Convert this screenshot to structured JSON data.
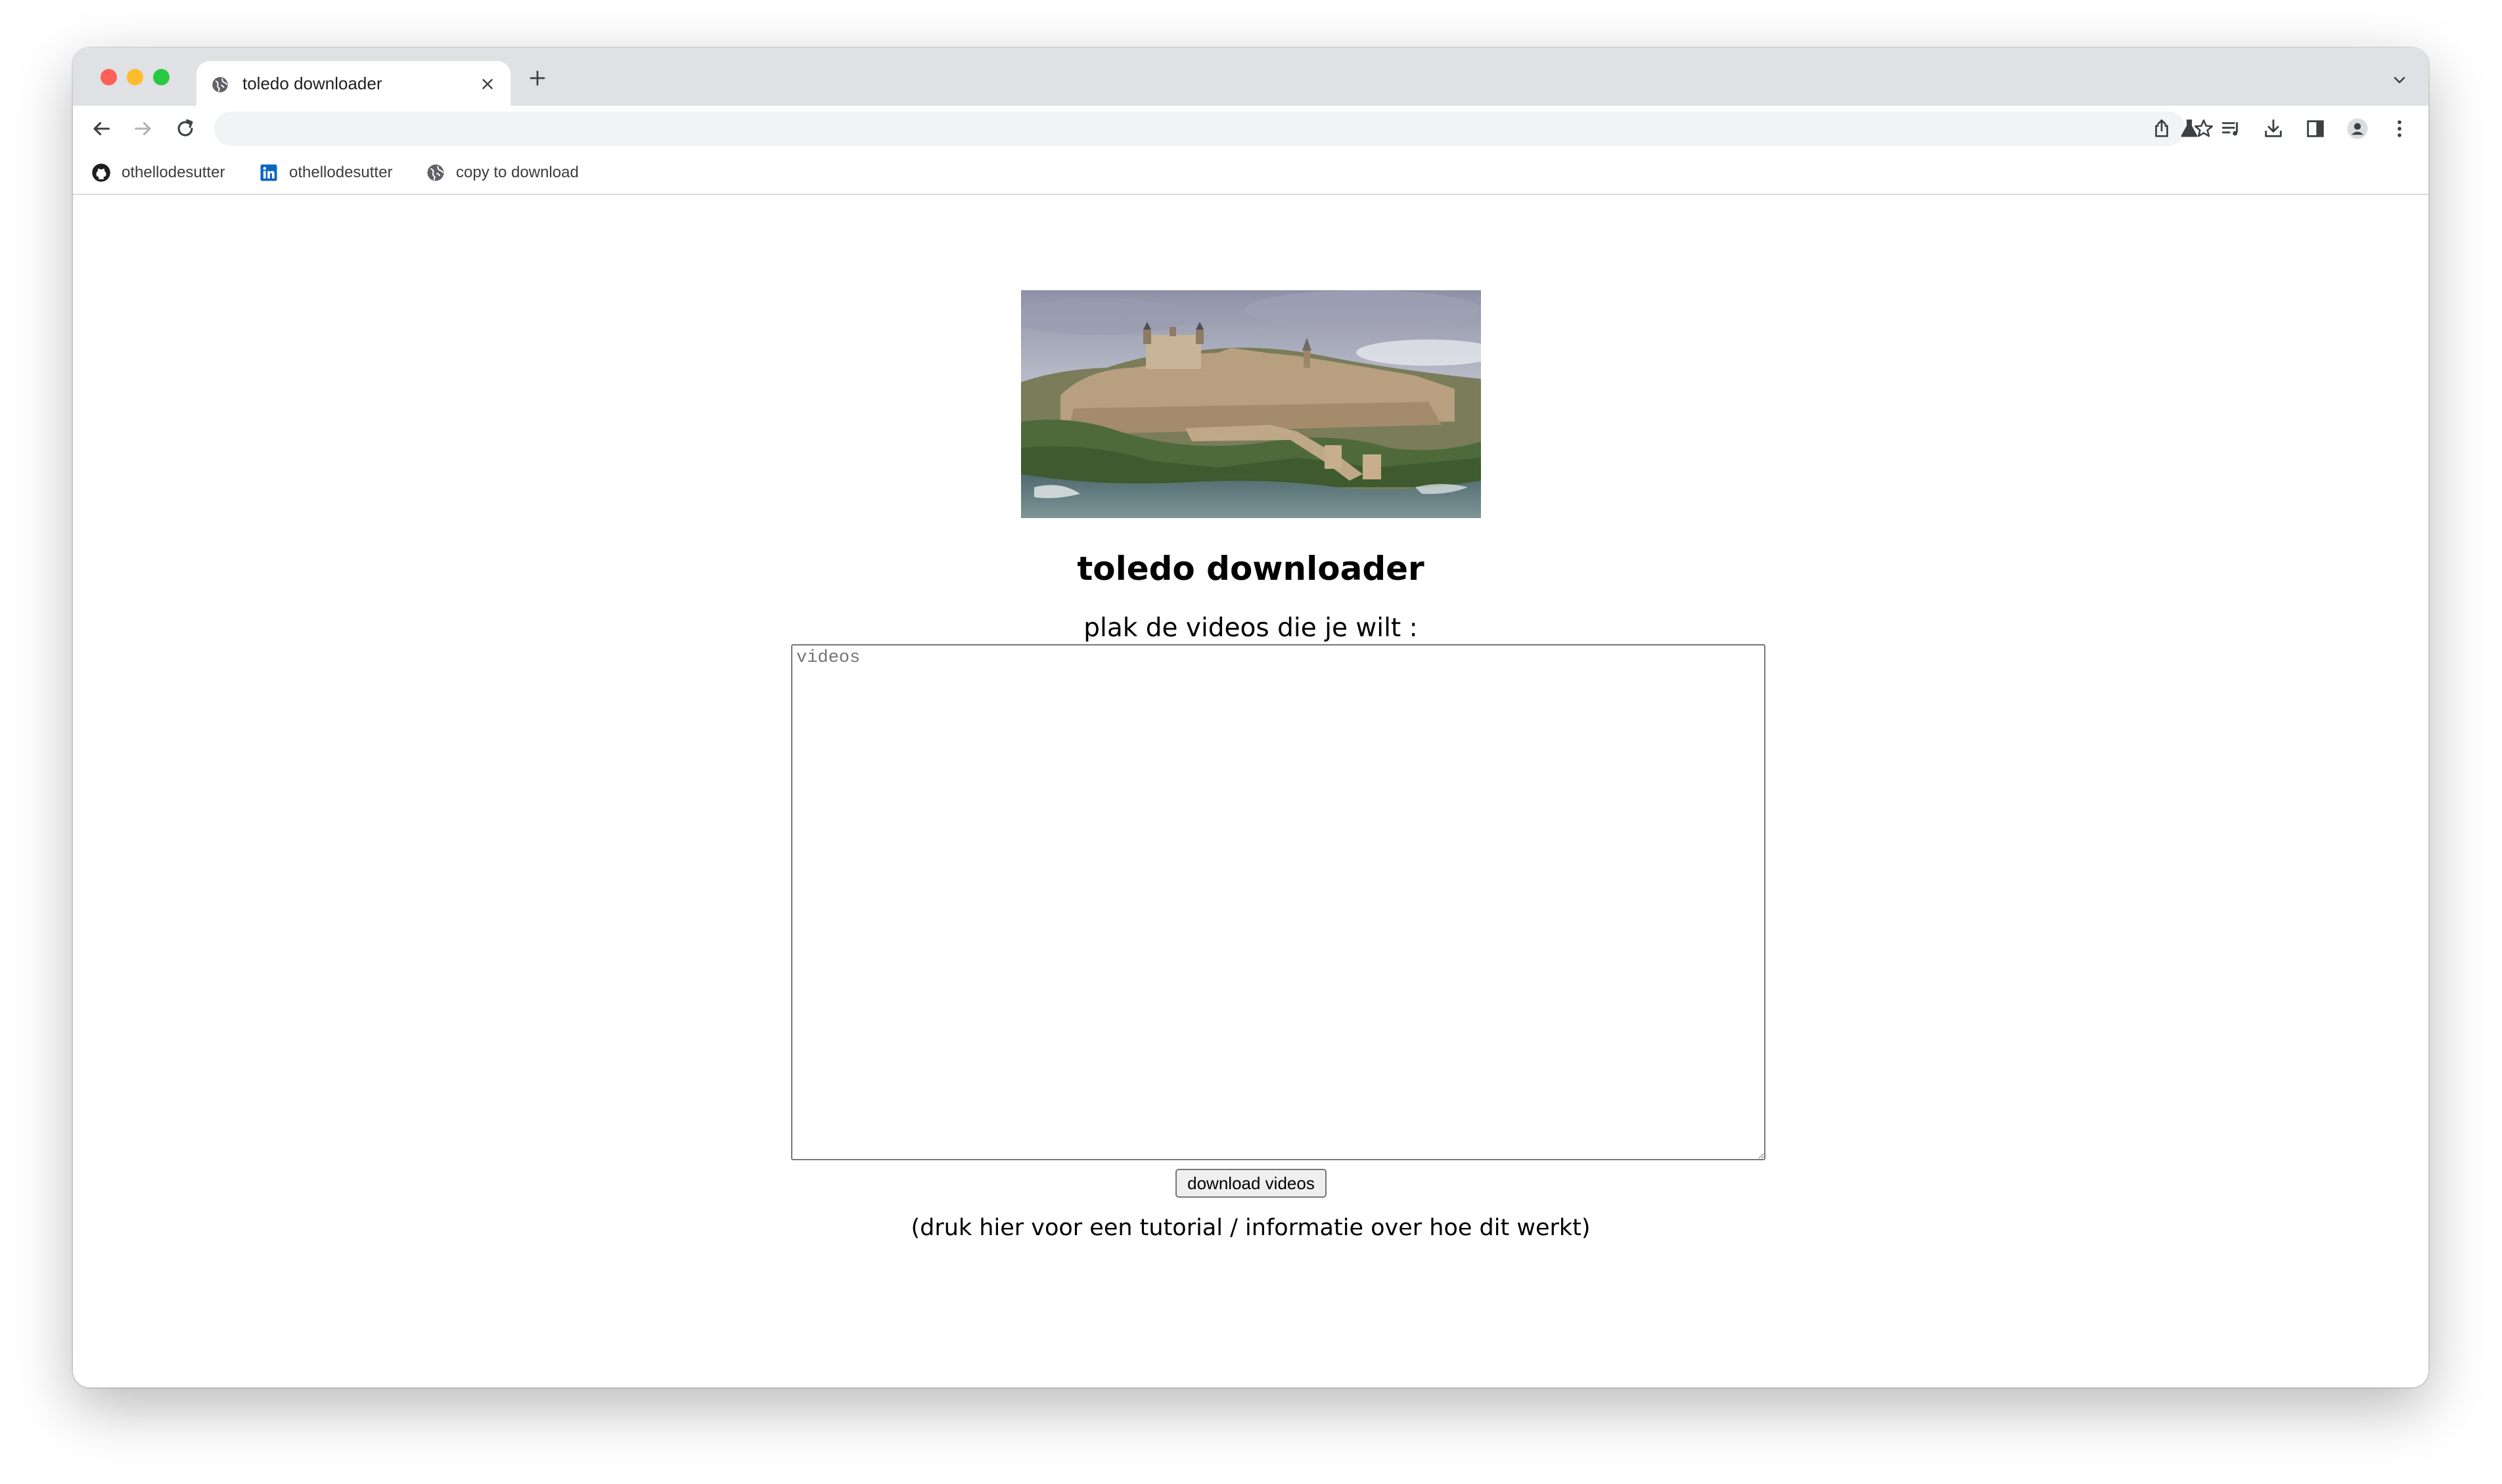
{
  "tab": {
    "title": "toledo downloader"
  },
  "bookmarks": [
    {
      "label": "othellodesutter",
      "icon": "github-icon"
    },
    {
      "label": "othellodesutter",
      "icon": "linkedin-icon"
    },
    {
      "label": "copy to download",
      "icon": "globe-icon"
    }
  ],
  "main": {
    "title": "toledo downloader",
    "subtitle": "plak de videos die je wilt :",
    "textarea_placeholder": "videos",
    "button_label": "download videos",
    "tutorial_link": "(druk hier voor een tutorial / informatie over hoe dit werkt)"
  }
}
